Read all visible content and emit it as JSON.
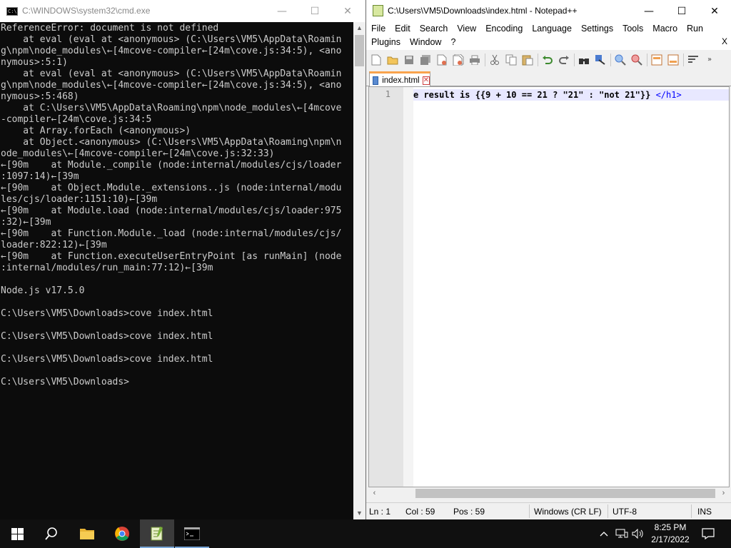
{
  "cmd": {
    "title": "C:\\WINDOWS\\system32\\cmd.exe",
    "icon_text": "C:\\",
    "lines": [
      "ReferenceError: document is not defined",
      "    at eval (eval at <anonymous> (C:\\Users\\VM5\\AppData\\Roamin",
      "g\\npm\\node_modules\\←[4mcove-compiler←[24m\\cove.js:34:5), <ano",
      "nymous>:5:1)",
      "    at eval (eval at <anonymous> (C:\\Users\\VM5\\AppData\\Roamin",
      "g\\npm\\node_modules\\←[4mcove-compiler←[24m\\cove.js:34:5), <ano",
      "nymous>:5:468)",
      "    at C:\\Users\\VM5\\AppData\\Roaming\\npm\\node_modules\\←[4mcove",
      "-compiler←[24m\\cove.js:34:5",
      "    at Array.forEach (<anonymous>)",
      "    at Object.<anonymous> (C:\\Users\\VM5\\AppData\\Roaming\\npm\\n",
      "ode_modules\\←[4mcove-compiler←[24m\\cove.js:32:33)",
      "←[90m    at Module._compile (node:internal/modules/cjs/loader",
      ":1097:14)←[39m",
      "←[90m    at Object.Module._extensions..js (node:internal/modu",
      "les/cjs/loader:1151:10)←[39m",
      "←[90m    at Module.load (node:internal/modules/cjs/loader:975",
      ":32)←[39m",
      "←[90m    at Function.Module._load (node:internal/modules/cjs/",
      "loader:822:12)←[39m",
      "←[90m    at Function.executeUserEntryPoint [as runMain] (node",
      ":internal/modules/run_main:77:12)←[39m",
      "",
      "Node.js v17.5.0",
      "",
      "C:\\Users\\VM5\\Downloads>cove index.html",
      "",
      "C:\\Users\\VM5\\Downloads>cove index.html",
      "",
      "C:\\Users\\VM5\\Downloads>cove index.html",
      "",
      "C:\\Users\\VM5\\Downloads>"
    ],
    "buttons": {
      "minimize": "—",
      "maximize": "☐",
      "close": "✕"
    }
  },
  "npp": {
    "title": "C:\\Users\\VM5\\Downloads\\index.html - Notepad++",
    "buttons": {
      "minimize": "—",
      "maximize": "☐",
      "close": "✕"
    },
    "menu_row1": [
      "File",
      "Edit",
      "Search",
      "View",
      "Encoding",
      "Language",
      "Settings",
      "Tools",
      "Macro",
      "Run"
    ],
    "menu_row2": [
      "Plugins",
      "Window",
      "?"
    ],
    "menu_close": "X",
    "tab_label": "index.html",
    "tab_close": "✕",
    "line_number": "1",
    "code_text": "e result is {{9 + 10 == 21 ? \"21\" : \"not 21\"}} ",
    "code_tag": "</h1>",
    "status": {
      "ln": "Ln : 1",
      "col": "Col : 59",
      "pos": "Pos : 59",
      "eol": "Windows (CR LF)",
      "encoding": "UTF-8",
      "mode": "INS"
    },
    "toolbar_icons": [
      "new-file-icon",
      "open-file-icon",
      "save-icon",
      "save-all-icon",
      "close-icon",
      "close-all-icon",
      "print-icon",
      "cut-icon",
      "copy-icon",
      "paste-icon",
      "undo-icon",
      "redo-icon",
      "find-icon",
      "replace-icon",
      "zoom-in-icon",
      "zoom-out-icon",
      "sync-v-icon",
      "sync-h-icon",
      "wrap-icon"
    ],
    "accent_color": "#f9a34d"
  },
  "taskbar": {
    "time": "8:25 PM",
    "date": "2/17/2022",
    "icons": [
      "start-icon",
      "search-icon",
      "file-explorer-icon",
      "chrome-icon",
      "notepadpp-icon",
      "cmd-icon"
    ]
  }
}
